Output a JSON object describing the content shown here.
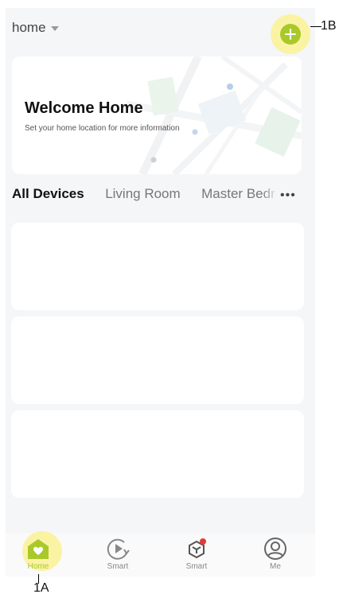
{
  "header": {
    "home_selector": "home",
    "add_button_callout": "1B"
  },
  "welcome": {
    "title": "Welcome Home",
    "subtitle": "Set your home location for more information"
  },
  "rooms": {
    "tabs": [
      {
        "label": "All Devices",
        "active": true
      },
      {
        "label": "Living Room",
        "active": false
      },
      {
        "label": "Master Bedroom",
        "active": false
      }
    ],
    "more_icon": "ellipsis-icon"
  },
  "tabbar": {
    "items": [
      {
        "label": "Home",
        "icon": "home-icon",
        "active": true
      },
      {
        "label": "Smart",
        "icon": "play-circle-icon",
        "active": false
      },
      {
        "label": "Smart",
        "icon": "cube-icon",
        "active": false,
        "badge": true
      },
      {
        "label": "Me",
        "icon": "profile-icon",
        "active": false
      }
    ],
    "home_callout": "1A"
  },
  "colors": {
    "accent": "#a9c92b",
    "highlight": "#fbf3a4",
    "badge": "#e53935",
    "background": "#f5f6f7"
  }
}
